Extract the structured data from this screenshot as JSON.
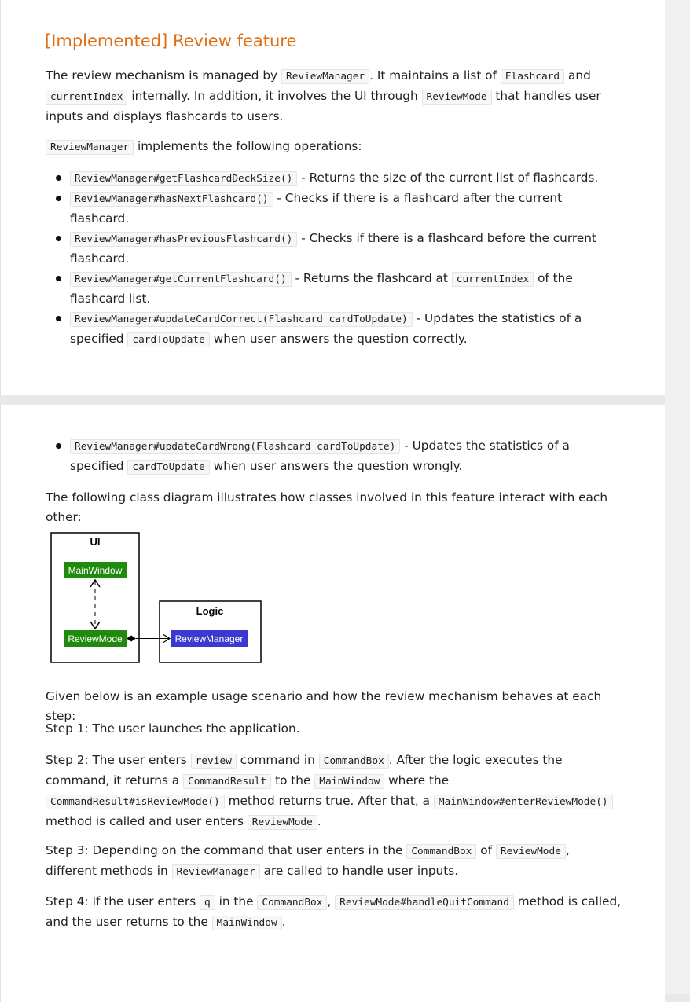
{
  "heading": "[Implemented] Review feature",
  "intro": {
    "t1": "The review mechanism is managed by ",
    "c1": "ReviewManager",
    "t2": ". It maintains a list of ",
    "c2": "Flashcard",
    "t3": " and ",
    "c3": "currentIndex",
    "t4": " internally. In addition, it involves the UI through ",
    "c4": "ReviewMode",
    "t5": " that handles user inputs and displays flashcards to users."
  },
  "ops_intro": {
    "c1": "ReviewManager",
    "t1": " implements the following operations:"
  },
  "operations": [
    {
      "code": "ReviewManager#getFlashcardDeckSize()",
      "text": " - Returns the size of the current list of flashcards."
    },
    {
      "code": "ReviewManager#hasNextFlashcard()",
      "text": " - Checks if there is a flashcard after the current flashcard."
    },
    {
      "code": "ReviewManager#hasPreviousFlashcard()",
      "text": " - Checks if there is a flashcard before the current flashcard."
    },
    {
      "code": "ReviewManager#getCurrentFlashcard()",
      "text": " - Returns the flashcard at ",
      "code2": "currentIndex",
      "text2": " of the flashcard list."
    },
    {
      "code": "ReviewManager#updateCardCorrect(Flashcard cardToUpdate)",
      "text": " - Updates the statistics of a specified ",
      "code2": "cardToUpdate",
      "text2": " when user answers the question correctly."
    },
    {
      "code": "ReviewManager#updateCardWrong(Flashcard cardToUpdate)",
      "text": " - Updates the statistics of a specified ",
      "code2": "cardToUpdate",
      "text2": " when user answers the question wrongly."
    }
  ],
  "diagram_caption": "The following class diagram illustrates how classes involved in this feature interact with each other:",
  "diagram": {
    "ui_label": "UI",
    "logic_label": "Logic",
    "main_window": "MainWindow",
    "review_mode": "ReviewMode",
    "review_manager": "ReviewManager",
    "colors": {
      "green": "#1f8a0d",
      "blue": "#3a3ad0"
    }
  },
  "scenario_intro": "Given below is an example usage scenario and how the review mechanism behaves at each step:",
  "step1": "Step 1: The user launches the application.",
  "step2": {
    "t1": "Step 2: The user enters ",
    "c1": "review",
    "t2": " command in ",
    "c2": "CommandBox",
    "t3": ". After the logic executes the command, it returns a ",
    "c3": "CommandResult",
    "t4": " to the ",
    "c4": "MainWindow",
    "t5": " where the ",
    "c5": "CommandResult#isReviewMode()",
    "t6": " method returns true. After that, a ",
    "c6": "MainWindow#enterReviewMode()",
    "t7": " method is called and user enters ",
    "c7": "ReviewMode",
    "t8": "."
  },
  "step3": {
    "t1": "Step 3: Depending on the command that user enters in the ",
    "c1": "CommandBox",
    "t2": " of ",
    "c2": "ReviewMode",
    "t3": ", different methods in ",
    "c3": "ReviewManager",
    "t4": " are called to handle user inputs."
  },
  "step4": {
    "t1": "Step 4: If the user enters ",
    "c1": "q",
    "t2": " in the ",
    "c2": "CommandBox",
    "t3": ", ",
    "c3": "ReviewMode#handleQuitCommand",
    "t4": " method is called, and the user returns to the ",
    "c4": "MainWindow",
    "t5": "."
  }
}
